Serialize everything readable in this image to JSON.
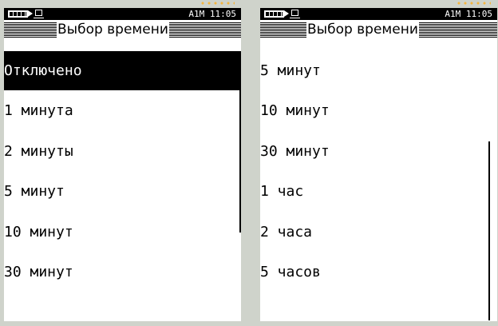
{
  "status": {
    "mode": "A1M",
    "time": "11:05"
  },
  "screens": [
    {
      "title": "Выбор времени",
      "items": [
        {
          "label": "Отключено",
          "selected": true
        },
        {
          "label": "1 минута",
          "selected": false
        },
        {
          "label": "2 минуты",
          "selected": false
        },
        {
          "label": "5 минут",
          "selected": false
        },
        {
          "label": "10 минут",
          "selected": false
        },
        {
          "label": "30 минут",
          "selected": false
        }
      ]
    },
    {
      "title": "Выбор времени",
      "items": [
        {
          "label": "5 минут",
          "selected": false
        },
        {
          "label": "10 минут",
          "selected": false
        },
        {
          "label": "30 минут",
          "selected": false
        },
        {
          "label": "1 час",
          "selected": false
        },
        {
          "label": "2 часа",
          "selected": false
        },
        {
          "label": "5 часов",
          "selected": false
        }
      ]
    }
  ],
  "colors": {
    "background": "#cfd3cb",
    "accent_dots": "#f4b540",
    "selection": "#000000"
  }
}
